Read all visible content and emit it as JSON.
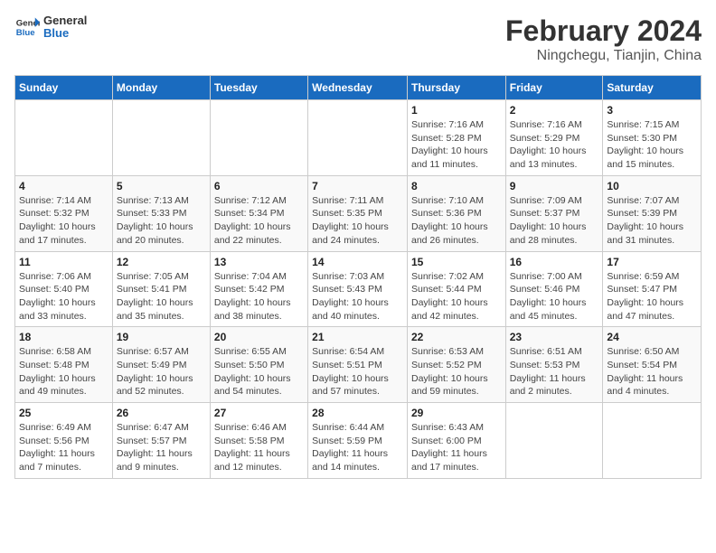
{
  "logo": {
    "line1": "General",
    "line2": "Blue"
  },
  "title": "February 2024",
  "subtitle": "Ningchegu, Tianjin, China",
  "weekdays": [
    "Sunday",
    "Monday",
    "Tuesday",
    "Wednesday",
    "Thursday",
    "Friday",
    "Saturday"
  ],
  "weeks": [
    [
      {
        "day": "",
        "info": ""
      },
      {
        "day": "",
        "info": ""
      },
      {
        "day": "",
        "info": ""
      },
      {
        "day": "",
        "info": ""
      },
      {
        "day": "1",
        "info": "Sunrise: 7:16 AM\nSunset: 5:28 PM\nDaylight: 10 hours and 11 minutes."
      },
      {
        "day": "2",
        "info": "Sunrise: 7:16 AM\nSunset: 5:29 PM\nDaylight: 10 hours and 13 minutes."
      },
      {
        "day": "3",
        "info": "Sunrise: 7:15 AM\nSunset: 5:30 PM\nDaylight: 10 hours and 15 minutes."
      }
    ],
    [
      {
        "day": "4",
        "info": "Sunrise: 7:14 AM\nSunset: 5:32 PM\nDaylight: 10 hours and 17 minutes."
      },
      {
        "day": "5",
        "info": "Sunrise: 7:13 AM\nSunset: 5:33 PM\nDaylight: 10 hours and 20 minutes."
      },
      {
        "day": "6",
        "info": "Sunrise: 7:12 AM\nSunset: 5:34 PM\nDaylight: 10 hours and 22 minutes."
      },
      {
        "day": "7",
        "info": "Sunrise: 7:11 AM\nSunset: 5:35 PM\nDaylight: 10 hours and 24 minutes."
      },
      {
        "day": "8",
        "info": "Sunrise: 7:10 AM\nSunset: 5:36 PM\nDaylight: 10 hours and 26 minutes."
      },
      {
        "day": "9",
        "info": "Sunrise: 7:09 AM\nSunset: 5:37 PM\nDaylight: 10 hours and 28 minutes."
      },
      {
        "day": "10",
        "info": "Sunrise: 7:07 AM\nSunset: 5:39 PM\nDaylight: 10 hours and 31 minutes."
      }
    ],
    [
      {
        "day": "11",
        "info": "Sunrise: 7:06 AM\nSunset: 5:40 PM\nDaylight: 10 hours and 33 minutes."
      },
      {
        "day": "12",
        "info": "Sunrise: 7:05 AM\nSunset: 5:41 PM\nDaylight: 10 hours and 35 minutes."
      },
      {
        "day": "13",
        "info": "Sunrise: 7:04 AM\nSunset: 5:42 PM\nDaylight: 10 hours and 38 minutes."
      },
      {
        "day": "14",
        "info": "Sunrise: 7:03 AM\nSunset: 5:43 PM\nDaylight: 10 hours and 40 minutes."
      },
      {
        "day": "15",
        "info": "Sunrise: 7:02 AM\nSunset: 5:44 PM\nDaylight: 10 hours and 42 minutes."
      },
      {
        "day": "16",
        "info": "Sunrise: 7:00 AM\nSunset: 5:46 PM\nDaylight: 10 hours and 45 minutes."
      },
      {
        "day": "17",
        "info": "Sunrise: 6:59 AM\nSunset: 5:47 PM\nDaylight: 10 hours and 47 minutes."
      }
    ],
    [
      {
        "day": "18",
        "info": "Sunrise: 6:58 AM\nSunset: 5:48 PM\nDaylight: 10 hours and 49 minutes."
      },
      {
        "day": "19",
        "info": "Sunrise: 6:57 AM\nSunset: 5:49 PM\nDaylight: 10 hours and 52 minutes."
      },
      {
        "day": "20",
        "info": "Sunrise: 6:55 AM\nSunset: 5:50 PM\nDaylight: 10 hours and 54 minutes."
      },
      {
        "day": "21",
        "info": "Sunrise: 6:54 AM\nSunset: 5:51 PM\nDaylight: 10 hours and 57 minutes."
      },
      {
        "day": "22",
        "info": "Sunrise: 6:53 AM\nSunset: 5:52 PM\nDaylight: 10 hours and 59 minutes."
      },
      {
        "day": "23",
        "info": "Sunrise: 6:51 AM\nSunset: 5:53 PM\nDaylight: 11 hours and 2 minutes."
      },
      {
        "day": "24",
        "info": "Sunrise: 6:50 AM\nSunset: 5:54 PM\nDaylight: 11 hours and 4 minutes."
      }
    ],
    [
      {
        "day": "25",
        "info": "Sunrise: 6:49 AM\nSunset: 5:56 PM\nDaylight: 11 hours and 7 minutes."
      },
      {
        "day": "26",
        "info": "Sunrise: 6:47 AM\nSunset: 5:57 PM\nDaylight: 11 hours and 9 minutes."
      },
      {
        "day": "27",
        "info": "Sunrise: 6:46 AM\nSunset: 5:58 PM\nDaylight: 11 hours and 12 minutes."
      },
      {
        "day": "28",
        "info": "Sunrise: 6:44 AM\nSunset: 5:59 PM\nDaylight: 11 hours and 14 minutes."
      },
      {
        "day": "29",
        "info": "Sunrise: 6:43 AM\nSunset: 6:00 PM\nDaylight: 11 hours and 17 minutes."
      },
      {
        "day": "",
        "info": ""
      },
      {
        "day": "",
        "info": ""
      }
    ]
  ]
}
